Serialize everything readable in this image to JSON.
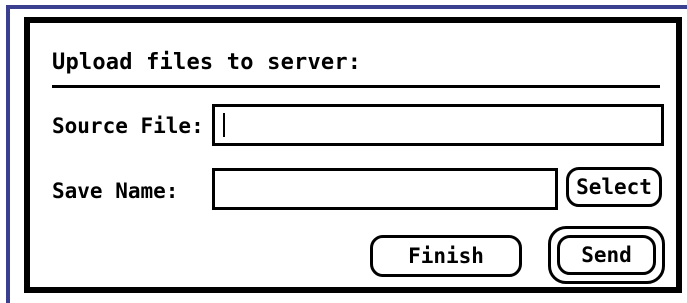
{
  "dialog": {
    "title": "Upload files to server:"
  },
  "form": {
    "source_file_label": "Source File:",
    "source_file_value": "",
    "save_name_label": "Save Name:",
    "save_name_value": ""
  },
  "buttons": {
    "select_label": "Select",
    "finish_label": "Finish",
    "send_label": "Send"
  },
  "colors": {
    "frame": "#3b3f8f",
    "ink": "#000000",
    "background": "#ffffff"
  }
}
